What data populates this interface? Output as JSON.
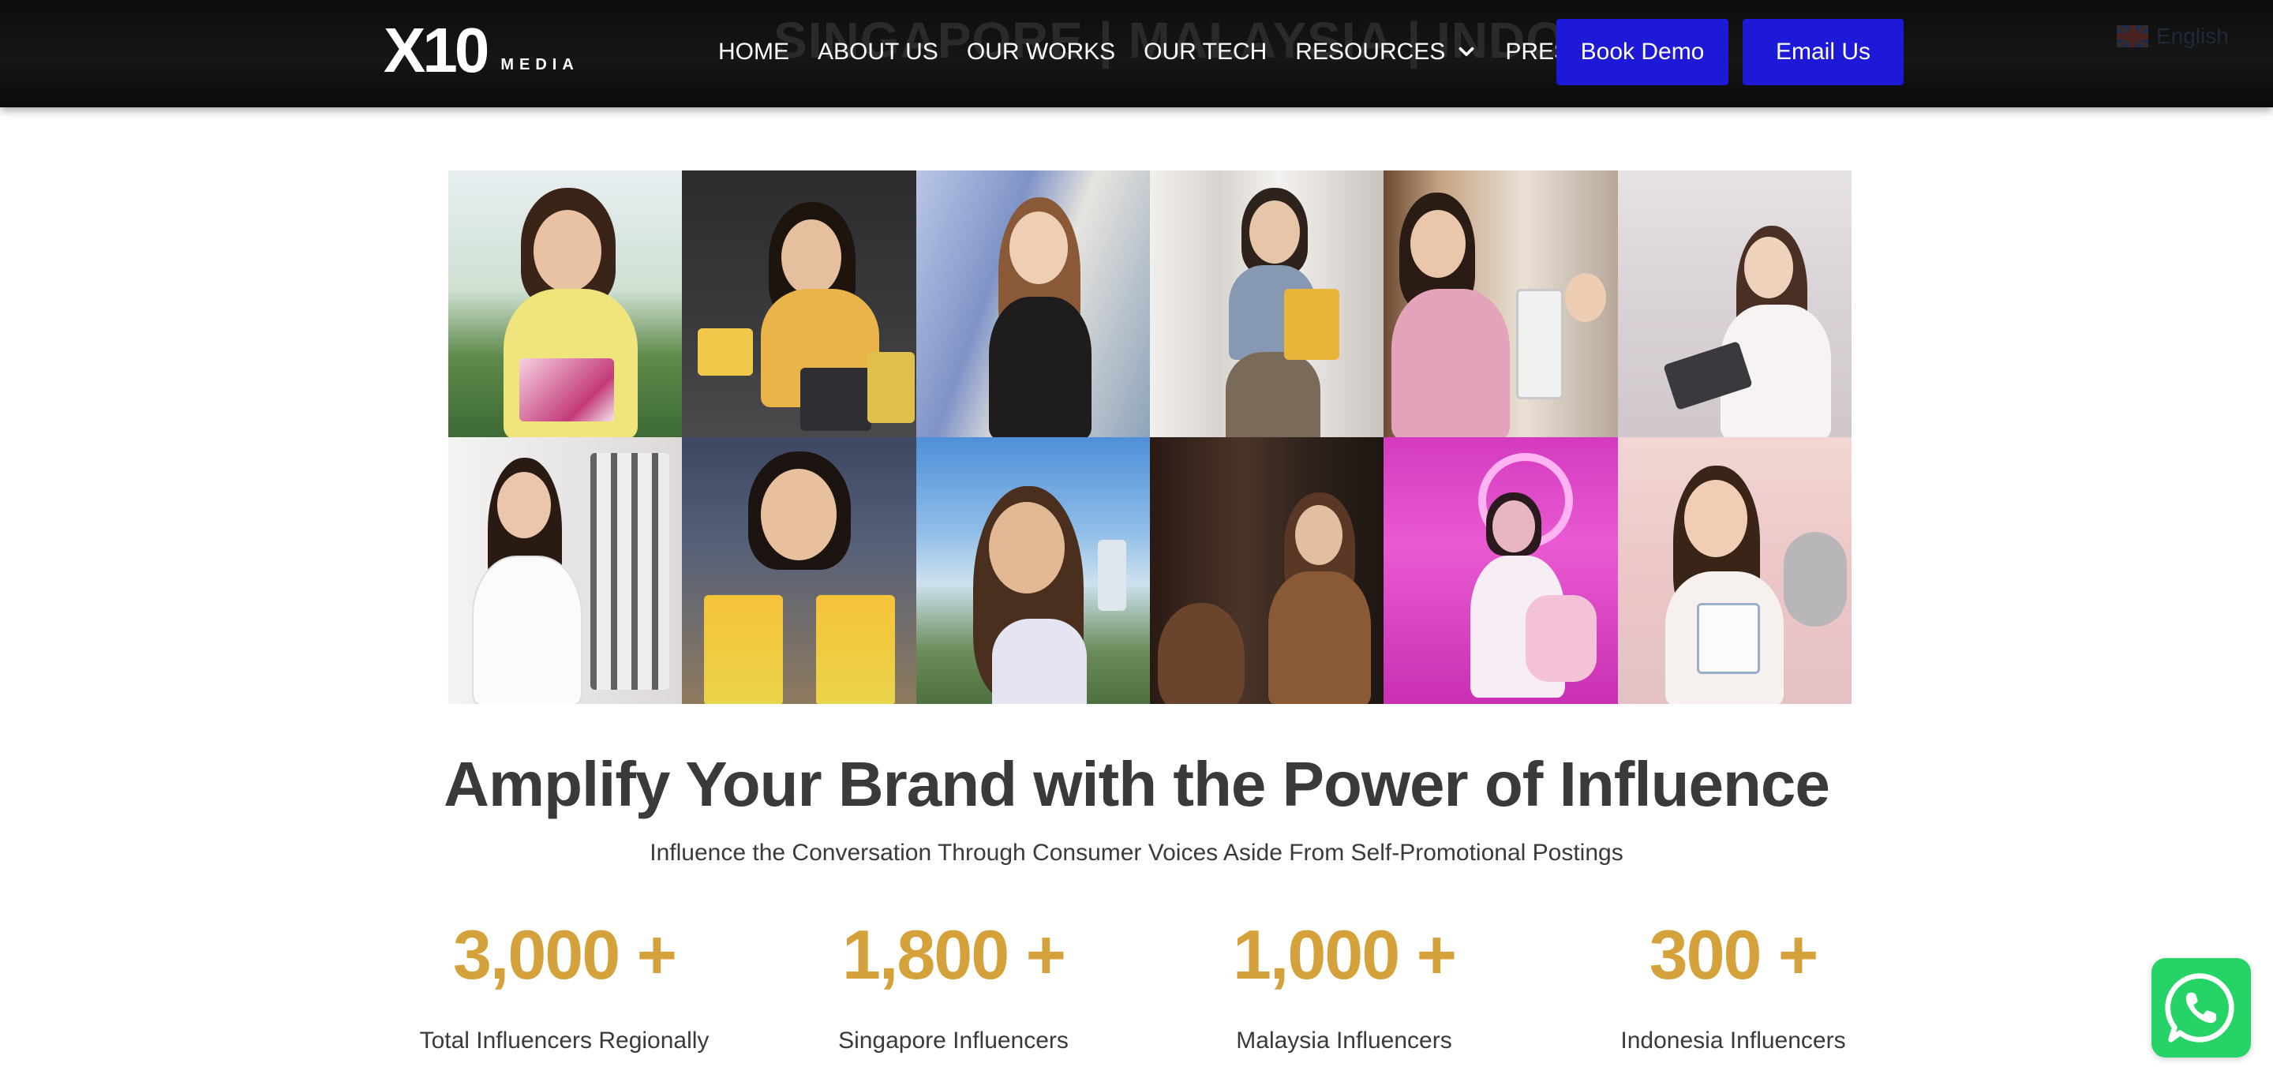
{
  "header": {
    "ghost_text": "SINGAPORE | MALAYSIA | INDONESIA",
    "logo": {
      "mark": "X10",
      "sub": "MEDIA"
    },
    "nav": [
      {
        "label": "HOME",
        "dropdown": false
      },
      {
        "label": "ABOUT US",
        "dropdown": false
      },
      {
        "label": "OUR WORKS",
        "dropdown": false
      },
      {
        "label": "OUR TECH",
        "dropdown": false
      },
      {
        "label": "RESOURCES",
        "dropdown": true
      },
      {
        "label": "PRESS",
        "dropdown": true
      }
    ],
    "book_demo": "Book Demo",
    "email_us": "Email Us",
    "language": "English",
    "accent_color": "#1d19d6"
  },
  "gallery": {
    "rows": 2,
    "columns": 6,
    "tiles": [
      {
        "subject": "woman with floral tissue boxes"
      },
      {
        "subject": "woman with snack packets"
      },
      {
        "subject": "woman posing by glass building"
      },
      {
        "subject": "woman with yellow backpack in library"
      },
      {
        "subject": "mother and child with water dispenser"
      },
      {
        "subject": "woman with tablet by window"
      },
      {
        "subject": "woman at watch display"
      },
      {
        "subject": "woman holding popcorn buckets"
      },
      {
        "subject": "woman outdoors holding drink can"
      },
      {
        "subject": "woman in store mirror"
      },
      {
        "subject": "woman seated in pink room"
      },
      {
        "subject": "woman with gift cards and plush toy"
      }
    ]
  },
  "hero": {
    "headline": "Amplify Your Brand with the Power of Influence",
    "subline": "Influence the Conversation Through Consumer Voices Aside From Self-Promotional Postings"
  },
  "stats": [
    {
      "value": "3,000 +",
      "label": "Total Influencers Regionally"
    },
    {
      "value": "1,800 +",
      "label": "Singapore Influencers"
    },
    {
      "value": "1,000 +",
      "label": "Malaysia Influencers"
    },
    {
      "value": "300 +",
      "label": "Indonesia Influencers"
    }
  ],
  "stat_color": "#d4a13a",
  "whatsapp": {
    "icon": "whatsapp-icon",
    "color": "#25d366"
  }
}
